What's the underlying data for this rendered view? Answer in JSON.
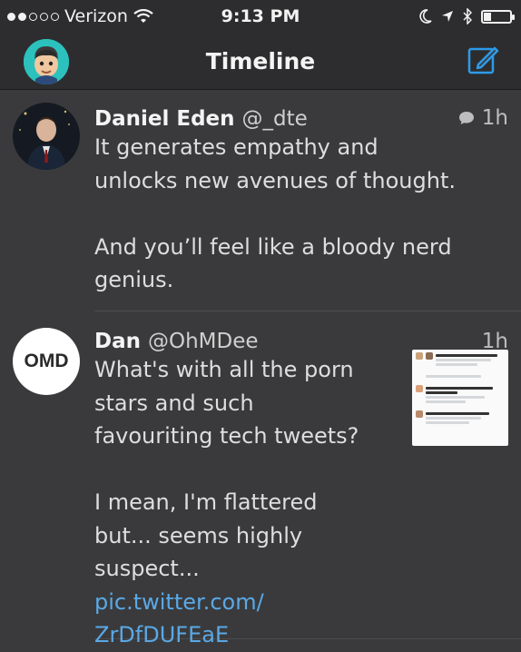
{
  "status_bar": {
    "carrier": "Verizon",
    "signal_bars_filled": 2,
    "signal_bars_total": 5,
    "time": "9:13 PM",
    "icons": [
      "wifi-icon",
      "moon-icon",
      "location-arrow-icon",
      "bluetooth-icon",
      "battery-icon"
    ],
    "battery_level": 0.25
  },
  "nav": {
    "title": "Timeline",
    "icons": [
      "profile-avatar",
      "compose-icon"
    ],
    "accent_color": "#2d9be8"
  },
  "tweets": [
    {
      "name": "Daniel Eden",
      "handle": "@_dte",
      "time": "1h",
      "has_reply_icon": true,
      "text": "It generates empathy and unlocks new avenues of thought.\n\nAnd you’ll feel like a bloody nerd genius."
    },
    {
      "name": "Dan",
      "handle": "@OhMDee",
      "avatar_text": "OMD",
      "time": "1h",
      "text": "What's with all the porn stars and such favouriting tech tweets?\n\nI mean, I'm flattered but... seems highly suspect...",
      "link_line1": "pic.twitter.com/",
      "link_line2": "ZrDfDUFEaE"
    }
  ],
  "colors": {
    "background": "#3a3a3c",
    "bar": "#2d2d2f",
    "link": "#5aa9e6",
    "avatar_teal": "#2cc1bc"
  }
}
